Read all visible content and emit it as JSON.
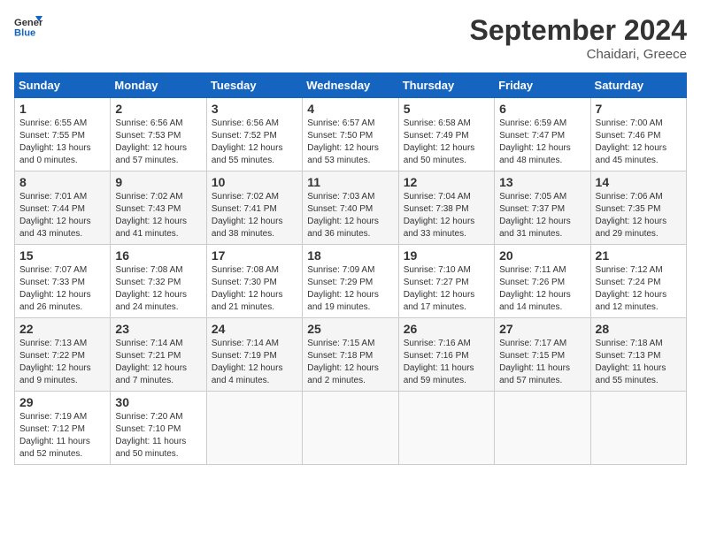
{
  "header": {
    "logo_line1": "General",
    "logo_line2": "Blue",
    "month": "September 2024",
    "location": "Chaidari, Greece"
  },
  "weekdays": [
    "Sunday",
    "Monday",
    "Tuesday",
    "Wednesday",
    "Thursday",
    "Friday",
    "Saturday"
  ],
  "weeks": [
    [
      {
        "day": "1",
        "sunrise": "Sunrise: 6:55 AM",
        "sunset": "Sunset: 7:55 PM",
        "daylight": "Daylight: 13 hours and 0 minutes."
      },
      {
        "day": "2",
        "sunrise": "Sunrise: 6:56 AM",
        "sunset": "Sunset: 7:53 PM",
        "daylight": "Daylight: 12 hours and 57 minutes."
      },
      {
        "day": "3",
        "sunrise": "Sunrise: 6:56 AM",
        "sunset": "Sunset: 7:52 PM",
        "daylight": "Daylight: 12 hours and 55 minutes."
      },
      {
        "day": "4",
        "sunrise": "Sunrise: 6:57 AM",
        "sunset": "Sunset: 7:50 PM",
        "daylight": "Daylight: 12 hours and 53 minutes."
      },
      {
        "day": "5",
        "sunrise": "Sunrise: 6:58 AM",
        "sunset": "Sunset: 7:49 PM",
        "daylight": "Daylight: 12 hours and 50 minutes."
      },
      {
        "day": "6",
        "sunrise": "Sunrise: 6:59 AM",
        "sunset": "Sunset: 7:47 PM",
        "daylight": "Daylight: 12 hours and 48 minutes."
      },
      {
        "day": "7",
        "sunrise": "Sunrise: 7:00 AM",
        "sunset": "Sunset: 7:46 PM",
        "daylight": "Daylight: 12 hours and 45 minutes."
      }
    ],
    [
      {
        "day": "8",
        "sunrise": "Sunrise: 7:01 AM",
        "sunset": "Sunset: 7:44 PM",
        "daylight": "Daylight: 12 hours and 43 minutes."
      },
      {
        "day": "9",
        "sunrise": "Sunrise: 7:02 AM",
        "sunset": "Sunset: 7:43 PM",
        "daylight": "Daylight: 12 hours and 41 minutes."
      },
      {
        "day": "10",
        "sunrise": "Sunrise: 7:02 AM",
        "sunset": "Sunset: 7:41 PM",
        "daylight": "Daylight: 12 hours and 38 minutes."
      },
      {
        "day": "11",
        "sunrise": "Sunrise: 7:03 AM",
        "sunset": "Sunset: 7:40 PM",
        "daylight": "Daylight: 12 hours and 36 minutes."
      },
      {
        "day": "12",
        "sunrise": "Sunrise: 7:04 AM",
        "sunset": "Sunset: 7:38 PM",
        "daylight": "Daylight: 12 hours and 33 minutes."
      },
      {
        "day": "13",
        "sunrise": "Sunrise: 7:05 AM",
        "sunset": "Sunset: 7:37 PM",
        "daylight": "Daylight: 12 hours and 31 minutes."
      },
      {
        "day": "14",
        "sunrise": "Sunrise: 7:06 AM",
        "sunset": "Sunset: 7:35 PM",
        "daylight": "Daylight: 12 hours and 29 minutes."
      }
    ],
    [
      {
        "day": "15",
        "sunrise": "Sunrise: 7:07 AM",
        "sunset": "Sunset: 7:33 PM",
        "daylight": "Daylight: 12 hours and 26 minutes."
      },
      {
        "day": "16",
        "sunrise": "Sunrise: 7:08 AM",
        "sunset": "Sunset: 7:32 PM",
        "daylight": "Daylight: 12 hours and 24 minutes."
      },
      {
        "day": "17",
        "sunrise": "Sunrise: 7:08 AM",
        "sunset": "Sunset: 7:30 PM",
        "daylight": "Daylight: 12 hours and 21 minutes."
      },
      {
        "day": "18",
        "sunrise": "Sunrise: 7:09 AM",
        "sunset": "Sunset: 7:29 PM",
        "daylight": "Daylight: 12 hours and 19 minutes."
      },
      {
        "day": "19",
        "sunrise": "Sunrise: 7:10 AM",
        "sunset": "Sunset: 7:27 PM",
        "daylight": "Daylight: 12 hours and 17 minutes."
      },
      {
        "day": "20",
        "sunrise": "Sunrise: 7:11 AM",
        "sunset": "Sunset: 7:26 PM",
        "daylight": "Daylight: 12 hours and 14 minutes."
      },
      {
        "day": "21",
        "sunrise": "Sunrise: 7:12 AM",
        "sunset": "Sunset: 7:24 PM",
        "daylight": "Daylight: 12 hours and 12 minutes."
      }
    ],
    [
      {
        "day": "22",
        "sunrise": "Sunrise: 7:13 AM",
        "sunset": "Sunset: 7:22 PM",
        "daylight": "Daylight: 12 hours and 9 minutes."
      },
      {
        "day": "23",
        "sunrise": "Sunrise: 7:14 AM",
        "sunset": "Sunset: 7:21 PM",
        "daylight": "Daylight: 12 hours and 7 minutes."
      },
      {
        "day": "24",
        "sunrise": "Sunrise: 7:14 AM",
        "sunset": "Sunset: 7:19 PM",
        "daylight": "Daylight: 12 hours and 4 minutes."
      },
      {
        "day": "25",
        "sunrise": "Sunrise: 7:15 AM",
        "sunset": "Sunset: 7:18 PM",
        "daylight": "Daylight: 12 hours and 2 minutes."
      },
      {
        "day": "26",
        "sunrise": "Sunrise: 7:16 AM",
        "sunset": "Sunset: 7:16 PM",
        "daylight": "Daylight: 11 hours and 59 minutes."
      },
      {
        "day": "27",
        "sunrise": "Sunrise: 7:17 AM",
        "sunset": "Sunset: 7:15 PM",
        "daylight": "Daylight: 11 hours and 57 minutes."
      },
      {
        "day": "28",
        "sunrise": "Sunrise: 7:18 AM",
        "sunset": "Sunset: 7:13 PM",
        "daylight": "Daylight: 11 hours and 55 minutes."
      }
    ],
    [
      {
        "day": "29",
        "sunrise": "Sunrise: 7:19 AM",
        "sunset": "Sunset: 7:12 PM",
        "daylight": "Daylight: 11 hours and 52 minutes."
      },
      {
        "day": "30",
        "sunrise": "Sunrise: 7:20 AM",
        "sunset": "Sunset: 7:10 PM",
        "daylight": "Daylight: 11 hours and 50 minutes."
      },
      null,
      null,
      null,
      null,
      null
    ]
  ]
}
